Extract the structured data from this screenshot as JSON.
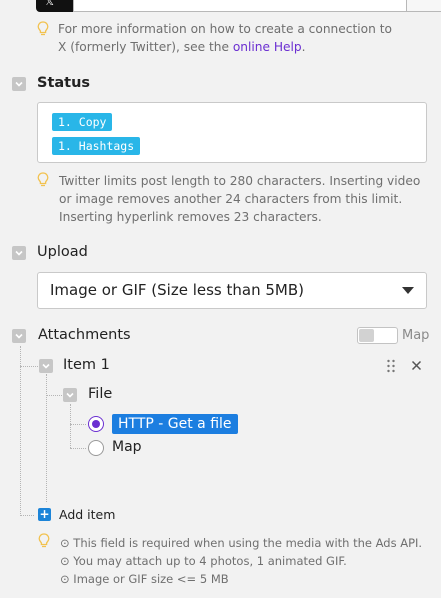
{
  "connection": {
    "logo_text": "𝕏",
    "field_value": ""
  },
  "connection_hint": {
    "text_before": "For more information on how to create a connection to X (formerly Twitter), see the ",
    "link_text": "online Help",
    "text_after": "."
  },
  "status": {
    "label": "Status",
    "pills": [
      "1. Copy",
      "1. Hashtags"
    ],
    "hint": "Twitter limits post length to 280 characters. Inserting video or image removes another 24 characters from this limit. Inserting hyperlink removes 23 characters."
  },
  "upload": {
    "label": "Upload",
    "selected": "Image or GIF (Size less than 5MB)"
  },
  "attachments": {
    "label": "Attachments",
    "map_label": "Map",
    "item": {
      "label": "Item 1",
      "file": {
        "label": "File",
        "options": [
          {
            "label": "HTTP - Get a file",
            "checked": true
          },
          {
            "label": "Map",
            "checked": false
          }
        ]
      }
    },
    "add_item_label": "Add item",
    "notes": [
      "This field is required when using the media with the Ads API.",
      "You may attach up to 4 photos, 1 animated GIF.",
      "Image or GIF size <= 5 MB"
    ]
  },
  "colors": {
    "accent": "#6b2fd1",
    "pill": "#29b6e8",
    "chip": "#1c7ee0",
    "bulb": "#f2c24f"
  }
}
